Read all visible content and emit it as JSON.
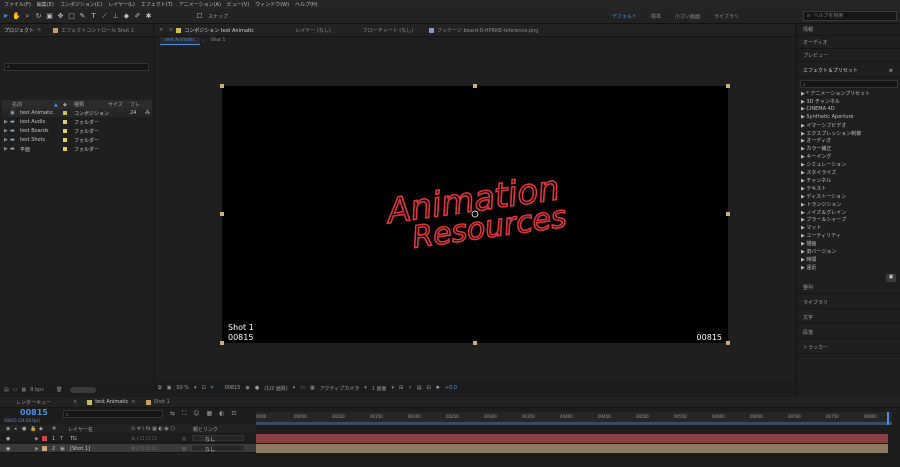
{
  "menu": [
    "ファイル(F)",
    "編集(E)",
    "コンポジション(C)",
    "レイヤー(L)",
    "エフェクト(T)",
    "アニメーション(A)",
    "ビュー(V)",
    "ウィンドウ(W)",
    "ヘルプ(H)"
  ],
  "toolbar": {
    "snap_label": "スナップ"
  },
  "workspaces": [
    "デフォルト",
    "標準",
    "小さい画面",
    "ライブラリ"
  ],
  "help_search": {
    "placeholder": "ヘルプを検索"
  },
  "project": {
    "tab": "プロジェクト",
    "effect_control_tab": "エフェクトコントロール Shot 1",
    "columns": {
      "name": "名前",
      "type": "種類",
      "size": "サイズ",
      "frame": "フレ"
    },
    "items": [
      {
        "name": "test Animatic",
        "type": "コンポジション",
        "size": "24",
        "color": "#c8c05a"
      },
      {
        "name": "test Audio",
        "type": "フォルダー",
        "size": "",
        "color": "#e0d060"
      },
      {
        "name": "test Boards",
        "type": "フォルダー",
        "size": "",
        "color": "#e0d060"
      },
      {
        "name": "test Shots",
        "type": "フォルダー",
        "size": "",
        "color": "#e0d060"
      },
      {
        "name": "平面",
        "type": "フォルダー",
        "size": "",
        "color": "#e0d060"
      }
    ],
    "bit_depth": "8 bpc"
  },
  "composition": {
    "tab": "コンポジション test Animatic",
    "layer_tab": "レイヤー (なし)",
    "flowchart_tab": "フローチャート (なし)",
    "footage_tab": "フッテージ board-8-HPRKB-reference.png",
    "sub_tabs": [
      "test Animatic",
      "Shot 1"
    ],
    "handwriting_line1": "Animation",
    "handwriting_line2": "Resources",
    "shot_label": "Shot 1",
    "frame_left": "00815",
    "frame_right": "00815",
    "zoom": "50 %",
    "current_frame": "00815",
    "resolution": "(1/2 画質)",
    "camera": "アクティブカメラ",
    "views": "1 画面",
    "exposure": "+0.0",
    "handwriting_color": "#e0353b"
  },
  "right_panels": {
    "info": "情報",
    "audio": "オーディオ",
    "preview": "プレビュー",
    "effects_presets": "エフェクト＆プリセット",
    "effects": [
      "▶ * アニメーションプリセット",
      "▶ 3D チャンネル",
      "▶ CINEMA 4D",
      "▶ Synthetic Aperture",
      "▶ イマーシブビデオ",
      "▶ エクスプレッション制御",
      "▶ オーディオ",
      "▶ カラー補正",
      "▶ キーイング",
      "▶ シミュレーション",
      "▶ スタイライズ",
      "▶ チャンネル",
      "▶ テキスト",
      "▶ ディストーション",
      "▶ トランジション",
      "▶ ノイズ＆グレイン",
      "▶ ブラー＆シャープ",
      "▶ マット",
      "▶ ユーティリティ",
      "▶ 描画",
      "▶ 旧バージョン",
      "▶ 時間",
      "▶ 遠近"
    ],
    "align": "整列",
    "library": "ライブラリ",
    "text": "文字",
    "paragraph": "段落",
    "tracker": "トラッカー"
  },
  "timeline": {
    "render_queue_tab": "レンダーキュー",
    "comp_tab": "test Animatic",
    "shot_tab": "Shot 1",
    "timecode": "00815",
    "fps": "00815 (24.00 fps)",
    "columns": {
      "num": "#",
      "name": "レイヤー名",
      "parent": "親とリンク"
    },
    "ruler": [
      "0000",
      "00050",
      "00100",
      "00150",
      "00200",
      "00250",
      "00300",
      "00350",
      "00400",
      "00450",
      "00500",
      "00550",
      "00600",
      "00650",
      "00700",
      "00750",
      "00800"
    ],
    "layers": [
      {
        "num": "1",
        "name": "TG",
        "parent": "なし",
        "color": "#c84a4a",
        "bar_color": "#8a4040"
      },
      {
        "num": "2",
        "name": "[Shot 1]",
        "parent": "なし",
        "color": "#c8a878",
        "bar_color": "#8a7a60"
      }
    ]
  }
}
